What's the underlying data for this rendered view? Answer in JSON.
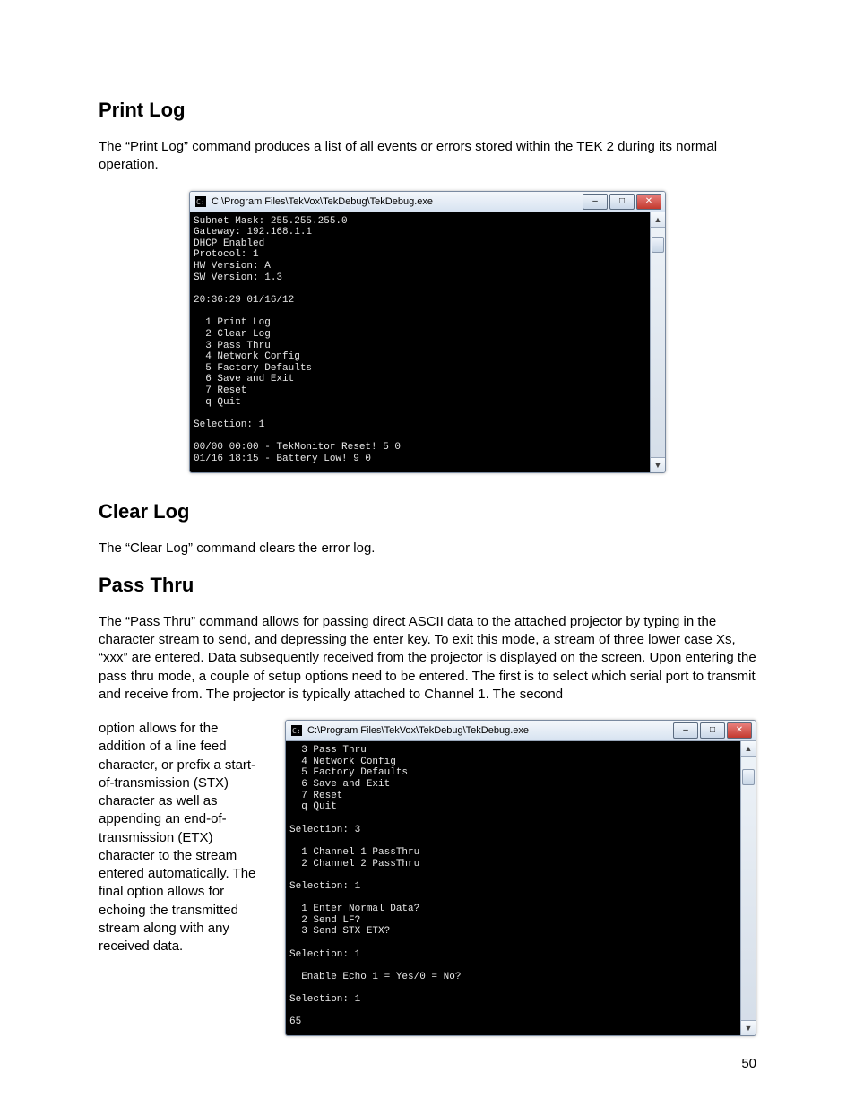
{
  "sections": {
    "printLog": {
      "heading": "Print Log",
      "para": "The “Print Log” command produces a list of all events or errors stored within the TEK 2 during its normal operation."
    },
    "clearLog": {
      "heading": "Clear Log",
      "para": "The “Clear Log” command clears the error log."
    },
    "passThru": {
      "heading": "Pass Thru",
      "para1": "The “Pass Thru” command allows for passing direct ASCII data to the attached projector by typing in the character stream to send, and depressing the enter key.  To exit this mode, a stream of three lower case Xs, “xxx” are entered.  Data subsequently received from the projector is displayed on the screen.  Upon entering the pass thru mode, a couple of setup options need to be entered.  The first is to select which serial port to transmit and receive from.  The projector is typically attached to Channel 1.  The second",
      "para2": "option allows for the addition of a line feed character, or prefix a start-of-transmission (STX) character as well as appending an end-of-transmission (ETX) character to the stream entered automatically.  The final option allows for echoing the transmitted stream along with any received data."
    }
  },
  "cmd1": {
    "title": "C:\\Program Files\\TekVox\\TekDebug\\TekDebug.exe",
    "content": "Subnet Mask: 255.255.255.0\nGateway: 192.168.1.1\nDHCP Enabled\nProtocol: 1\nHW Version: A\nSW Version: 1.3\n\n20:36:29 01/16/12\n\n  1 Print Log\n  2 Clear Log\n  3 Pass Thru\n  4 Network Config\n  5 Factory Defaults\n  6 Save and Exit\n  7 Reset\n  q Quit\n\nSelection: 1\n\n00/00 00:00 - TekMonitor Reset! 5 0\n01/16 18:15 - Battery Low! 9 0"
  },
  "cmd2": {
    "title": "C:\\Program Files\\TekVox\\TekDebug\\TekDebug.exe",
    "content": "  3 Pass Thru\n  4 Network Config\n  5 Factory Defaults\n  6 Save and Exit\n  7 Reset\n  q Quit\n\nSelection: 3\n\n  1 Channel 1 PassThru\n  2 Channel 2 PassThru\n\nSelection: 1\n\n  1 Enter Normal Data?\n  2 Send LF?\n  3 Send STX ETX?\n\nSelection: 1\n\n  Enable Echo 1 = Yes/0 = No?\n\nSelection: 1\n\n65"
  },
  "windowButtons": {
    "min": "–",
    "max": "□",
    "close": "✕"
  },
  "pageNumber": "50"
}
